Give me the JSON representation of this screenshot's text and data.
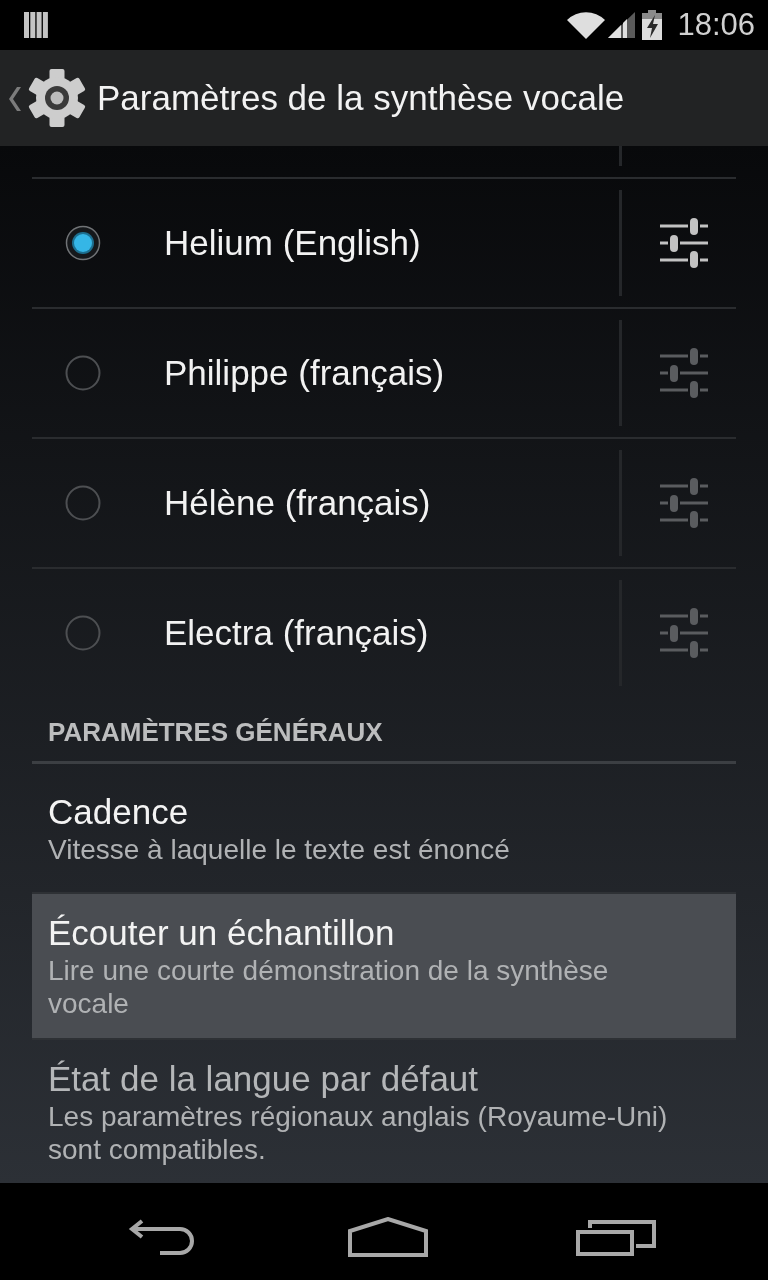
{
  "status_bar": {
    "time": "18:06"
  },
  "action_bar": {
    "title": "Paramètres de la synthèse vocale"
  },
  "voices": [
    {
      "name": "Helium (English)",
      "selected": true,
      "settings_enabled": true
    },
    {
      "name": "Philippe (français)",
      "selected": false,
      "settings_enabled": false
    },
    {
      "name": "Hélène (français)",
      "selected": false,
      "settings_enabled": false
    },
    {
      "name": "Electra (français)",
      "selected": false,
      "settings_enabled": false
    }
  ],
  "section_header": {
    "title": "PARAMÈTRES GÉNÉRAUX"
  },
  "preferences": [
    {
      "title": "Cadence",
      "summary": "Vitesse à laquelle le texte est énoncé",
      "highlighted": false,
      "disabled": false
    },
    {
      "title": "Écouter un échantillon",
      "summary": "Lire une courte démonstration de la synthèse vocale",
      "highlighted": true,
      "disabled": false
    },
    {
      "title": "État de la langue par défaut",
      "summary": "Les paramètres régionaux anglais (Royaume-Uni) sont compatibles.",
      "highlighted": false,
      "disabled": true
    }
  ]
}
